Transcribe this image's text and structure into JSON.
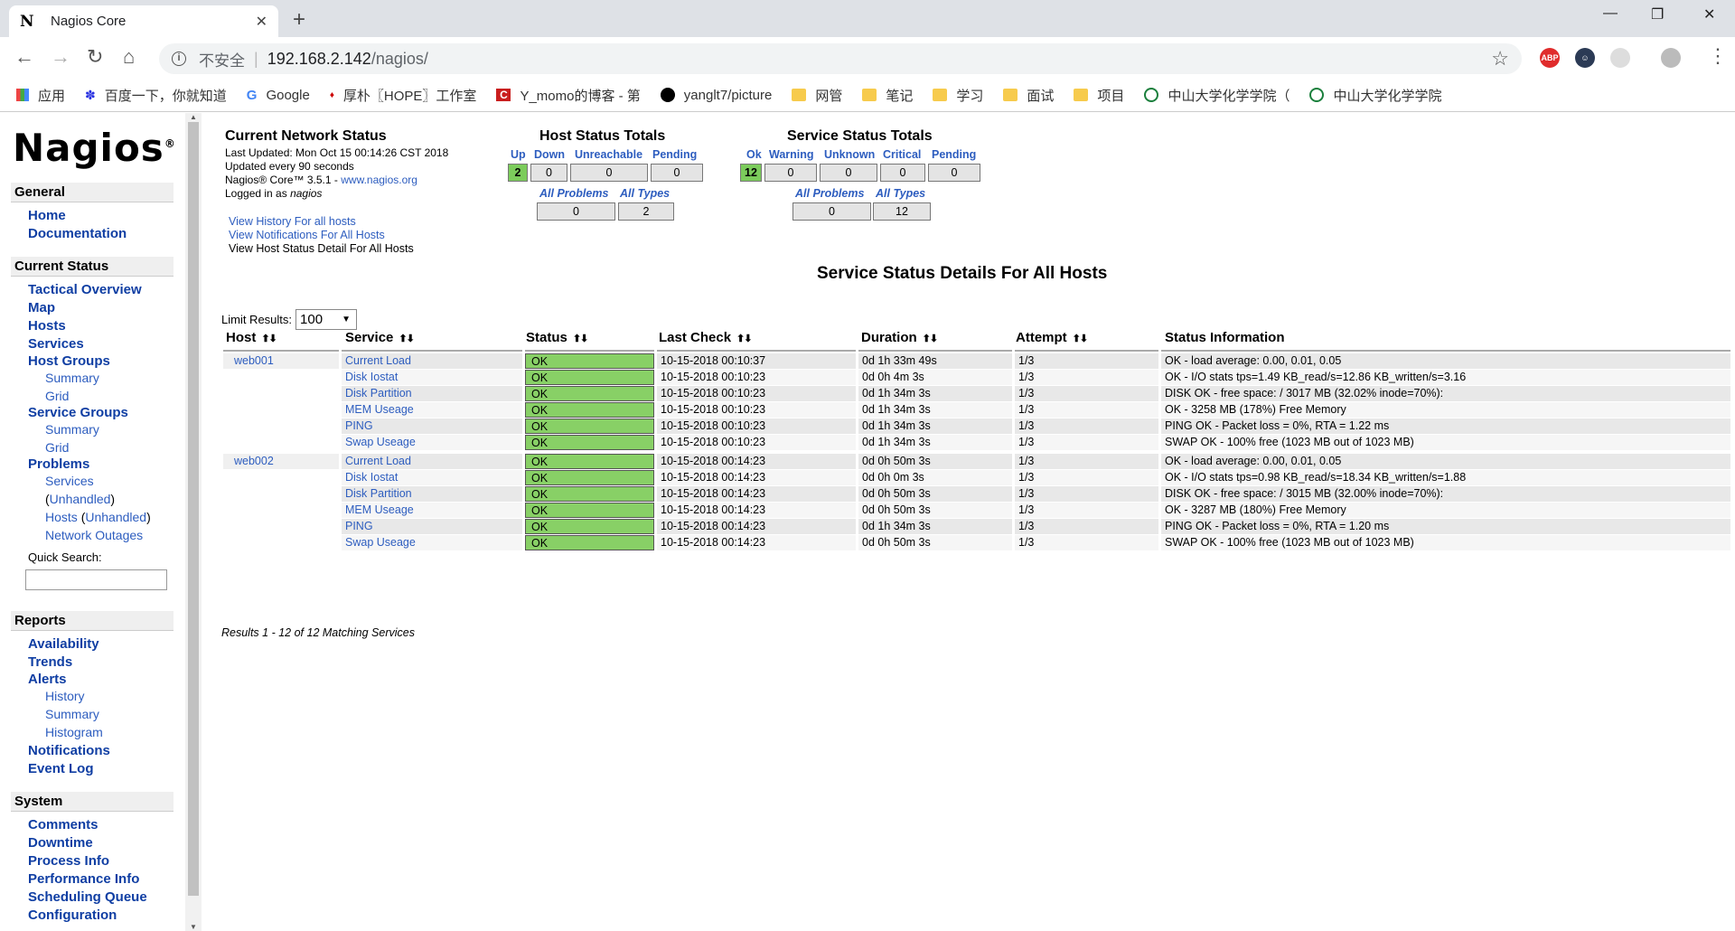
{
  "browser": {
    "tab_title": "Nagios Core",
    "favicon": "N",
    "address": {
      "security": "不安全",
      "host": "192.168.2.142",
      "path": "/nagios/"
    },
    "bookmarks": [
      {
        "label": "应用",
        "icon": "apps"
      },
      {
        "label": "百度一下，你就知道",
        "icon": "baidu"
      },
      {
        "label": "Google",
        "icon": "google"
      },
      {
        "label": "厚朴〖HOPE〗工作室",
        "icon": "hope"
      },
      {
        "label": "Y_momo的博客 - 第",
        "icon": "csdn"
      },
      {
        "label": "yanglt7/picture",
        "icon": "github"
      },
      {
        "label": "网管",
        "icon": "folder"
      },
      {
        "label": "笔记",
        "icon": "folder"
      },
      {
        "label": "学习",
        "icon": "folder"
      },
      {
        "label": "面试",
        "icon": "folder"
      },
      {
        "label": "项目",
        "icon": "folder"
      },
      {
        "label": "中山大学化学学院（",
        "icon": "sysu"
      },
      {
        "label": "中山大学化学学院",
        "icon": "sysu"
      }
    ],
    "extensions": [
      "ABP"
    ]
  },
  "sidebar": {
    "logo": "Nagios",
    "logo_mark": "®",
    "general": {
      "heading": "General",
      "items": [
        "Home",
        "Documentation"
      ]
    },
    "current_status": {
      "heading": "Current Status",
      "tactical": "Tactical Overview",
      "map": "Map",
      "hosts": "Hosts",
      "services": "Services",
      "host_groups": "Host Groups",
      "hg_summary": "Summary",
      "hg_grid": "Grid",
      "service_groups": "Service Groups",
      "sg_summary": "Summary",
      "sg_grid": "Grid",
      "problems": "Problems",
      "p_services": "Services",
      "p_unhandled": "Unhandled",
      "p_hosts": "Hosts",
      "p_hosts_unhandled": "Unhandled",
      "p_outages": "Network Outages",
      "quick_search": "Quick Search:"
    },
    "reports": {
      "heading": "Reports",
      "availability": "Availability",
      "trends": "Trends",
      "alerts": "Alerts",
      "history": "History",
      "summary": "Summary",
      "histogram": "Histogram",
      "notifications": "Notifications",
      "event_log": "Event Log"
    },
    "system": {
      "heading": "System",
      "comments": "Comments",
      "downtime": "Downtime",
      "process_info": "Process Info",
      "performance_info": "Performance Info",
      "scheduling_queue": "Scheduling Queue",
      "configuration": "Configuration"
    }
  },
  "network_status": {
    "title": "Current Network Status",
    "last_updated": "Last Updated: Mon Oct 15 00:14:26 CST 2018",
    "update_interval": "Updated every 90 seconds",
    "version_prefix": "Nagios® Core™ 3.5.1 - ",
    "version_link": "www.nagios.org",
    "logged_in_prefix": "Logged in as ",
    "logged_in_user": "nagios",
    "links": [
      "View History For all hosts",
      "View Notifications For All Hosts",
      "View Host Status Detail For All Hosts"
    ]
  },
  "host_totals": {
    "title": "Host Status Totals",
    "headers": [
      "Up",
      "Down",
      "Unreachable",
      "Pending"
    ],
    "values": [
      "2",
      "0",
      "0",
      "0"
    ],
    "sub_headers": [
      "All Problems",
      "All Types"
    ],
    "sub_values": [
      "0",
      "2"
    ]
  },
  "service_totals": {
    "title": "Service Status Totals",
    "headers": [
      "Ok",
      "Warning",
      "Unknown",
      "Critical",
      "Pending"
    ],
    "values": [
      "12",
      "0",
      "0",
      "0",
      "0"
    ],
    "sub_headers": [
      "All Problems",
      "All Types"
    ],
    "sub_values": [
      "0",
      "12"
    ]
  },
  "details": {
    "title": "Service Status Details For All Hosts",
    "limit_label": "Limit Results:",
    "limit_value": "100",
    "columns": [
      "Host",
      "Service",
      "Status",
      "Last Check",
      "Duration",
      "Attempt",
      "Status Information"
    ],
    "sort_glyph": "⬆⬇",
    "rows": [
      {
        "host": "web001",
        "service": "Current Load",
        "status": "OK",
        "last_check": "10-15-2018 00:10:37",
        "duration": "0d 1h 33m 49s",
        "attempt": "1/3",
        "info": "OK - load average: 0.00, 0.01, 0.05"
      },
      {
        "host": "",
        "service": "Disk Iostat",
        "status": "OK",
        "last_check": "10-15-2018 00:10:23",
        "duration": "0d 0h 4m 3s",
        "attempt": "1/3",
        "info": "OK - I/O stats tps=1.49 KB_read/s=12.86 KB_written/s=3.16"
      },
      {
        "host": "",
        "service": "Disk Partition",
        "status": "OK",
        "last_check": "10-15-2018 00:10:23",
        "duration": "0d 1h 34m 3s",
        "attempt": "1/3",
        "info": "DISK OK - free space: / 3017 MB (32.02% inode=70%):"
      },
      {
        "host": "",
        "service": "MEM Useage",
        "status": "OK",
        "last_check": "10-15-2018 00:10:23",
        "duration": "0d 1h 34m 3s",
        "attempt": "1/3",
        "info": "OK - 3258 MB (178%) Free Memory"
      },
      {
        "host": "",
        "service": "PING",
        "status": "OK",
        "last_check": "10-15-2018 00:10:23",
        "duration": "0d 1h 34m 3s",
        "attempt": "1/3",
        "info": "PING OK - Packet loss = 0%, RTA = 1.22 ms"
      },
      {
        "host": "",
        "service": "Swap Useage",
        "status": "OK",
        "last_check": "10-15-2018 00:10:23",
        "duration": "0d 1h 34m 3s",
        "attempt": "1/3",
        "info": "SWAP OK - 100% free (1023 MB out of 1023 MB)"
      },
      {
        "host": "web002",
        "service": "Current Load",
        "status": "OK",
        "last_check": "10-15-2018 00:14:23",
        "duration": "0d 0h 50m 3s",
        "attempt": "1/3",
        "info": "OK - load average: 0.00, 0.01, 0.05"
      },
      {
        "host": "",
        "service": "Disk Iostat",
        "status": "OK",
        "last_check": "10-15-2018 00:14:23",
        "duration": "0d 0h 0m 3s",
        "attempt": "1/3",
        "info": "OK - I/O stats tps=0.98 KB_read/s=18.34 KB_written/s=1.88"
      },
      {
        "host": "",
        "service": "Disk Partition",
        "status": "OK",
        "last_check": "10-15-2018 00:14:23",
        "duration": "0d 0h 50m 3s",
        "attempt": "1/3",
        "info": "DISK OK - free space: / 3015 MB (32.00% inode=70%):"
      },
      {
        "host": "",
        "service": "MEM Useage",
        "status": "OK",
        "last_check": "10-15-2018 00:14:23",
        "duration": "0d 0h 50m 3s",
        "attempt": "1/3",
        "info": "OK - 3287 MB (180%) Free Memory"
      },
      {
        "host": "",
        "service": "PING",
        "status": "OK",
        "last_check": "10-15-2018 00:14:23",
        "duration": "0d 1h 34m 3s",
        "attempt": "1/3",
        "info": "PING OK - Packet loss = 0%, RTA = 1.20 ms"
      },
      {
        "host": "",
        "service": "Swap Useage",
        "status": "OK",
        "last_check": "10-15-2018 00:14:23",
        "duration": "0d 0h 50m 3s",
        "attempt": "1/3",
        "info": "SWAP OK - 100% free (1023 MB out of 1023 MB)"
      }
    ],
    "results_text": "Results 1 - 12 of 12 Matching Services"
  },
  "colors": {
    "ok_green": "#88d066",
    "link_blue": "#2d5dbf",
    "nav_blue": "#0f3ea3"
  }
}
